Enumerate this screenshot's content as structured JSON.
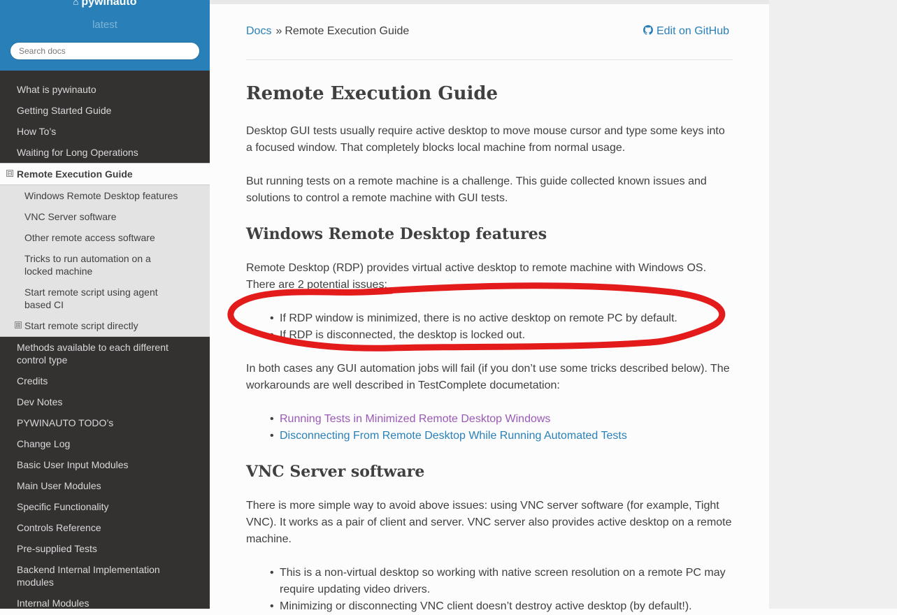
{
  "sidebar": {
    "project_name": "pywinauto",
    "version": "latest",
    "search_placeholder": "Search docs",
    "items": [
      {
        "label": "What is pywinauto"
      },
      {
        "label": "Getting Started Guide"
      },
      {
        "label": "How To’s"
      },
      {
        "label": "Waiting for Long Operations"
      },
      {
        "label": "Remote Execution Guide",
        "toggle": "⊟"
      },
      {
        "label": "Windows Remote Desktop features"
      },
      {
        "label": "VNC Server software"
      },
      {
        "label": "Other remote access software"
      },
      {
        "label": "Tricks to run automation on a locked machine"
      },
      {
        "label": "Start remote script using agent based CI"
      },
      {
        "label": "Start remote script directly",
        "toggle": "⊞"
      },
      {
        "label": "Methods available to each different control type"
      },
      {
        "label": "Credits"
      },
      {
        "label": "Dev Notes"
      },
      {
        "label": "PYWINAUTO TODO’s"
      },
      {
        "label": "Change Log"
      },
      {
        "label": "Basic User Input Modules"
      },
      {
        "label": "Main User Modules"
      },
      {
        "label": "Specific Functionality"
      },
      {
        "label": "Controls Reference"
      },
      {
        "label": "Pre-supplied Tests"
      },
      {
        "label": "Backend Internal Implementation modules"
      },
      {
        "label": "Internal Modules"
      }
    ]
  },
  "breadcrumbs": {
    "docs": "Docs",
    "separator": "»",
    "current": "Remote Execution Guide",
    "edit_link": "Edit on GitHub"
  },
  "article": {
    "title": "Remote Execution Guide",
    "intro1": "Desktop GUI tests usually require active desktop to move mouse cursor and type some keys into a focused window. That completely blocks local machine from normal usage.",
    "intro2": "But running tests on a remote machine is a challenge. This guide collected known issues and solutions to control a remote machine with GUI tests.",
    "section1_title": "Windows Remote Desktop features",
    "section1_p": "Remote Desktop (RDP) provides virtual active desktop to remote machine with Windows OS. There are 2 potential issues:",
    "section1_bullets": [
      "If RDP window is minimized, there is no active desktop on remote PC by default.",
      "If RDP is disconnected, the desktop is locked out."
    ],
    "section1_p2": "In both cases any GUI automation jobs will fail (if you don’t use some tricks described below). The workarounds are well described in TestComplete documetation:",
    "section1_links": [
      "Running Tests in Minimized Remote Desktop Windows",
      "Disconnecting From Remote Desktop While Running Automated Tests"
    ],
    "section2_title": "VNC Server software",
    "section2_p": "There is more simple way to avoid above issues: using VNC server software (for example, Tight VNC). It works as a pair of client and server. VNC server also provides active desktop on a remote machine.",
    "section2_bullets": [
      "This is a non-virtual desktop so working with native screen resolution on a remote PC may require updating video drivers.",
      "Minimizing or disconnecting VNC client doesn’t destroy active desktop (by default!)."
    ]
  },
  "colors": {
    "sidebar_bg": "#343131",
    "sidebar_header_bg": "#2980b9",
    "link": "#2980b9",
    "visited_link": "#9b59b6",
    "annotation": "#e31b1b"
  }
}
